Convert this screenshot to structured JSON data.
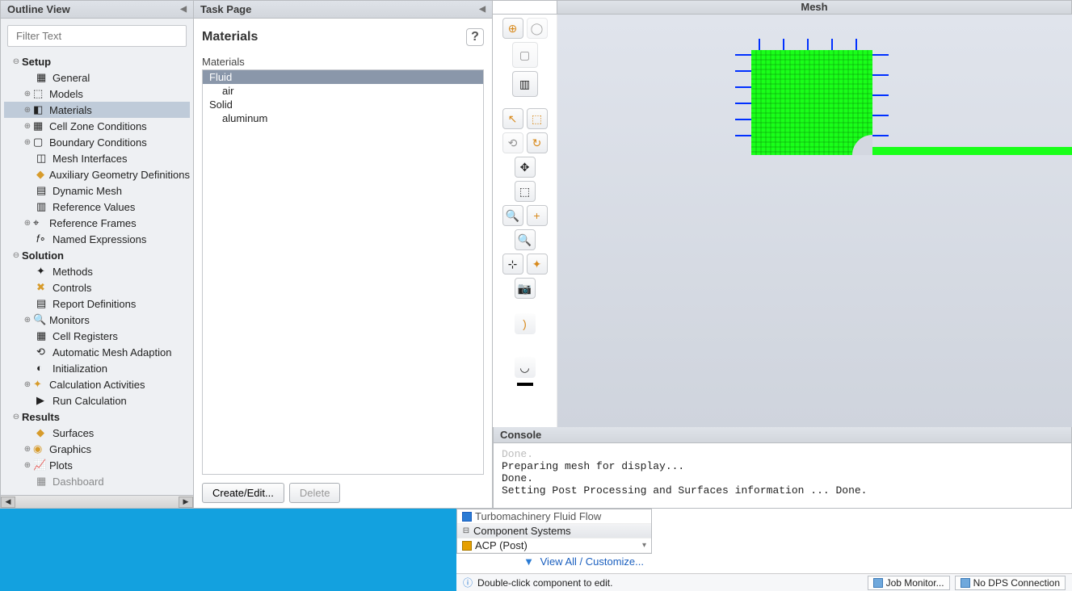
{
  "outline": {
    "title": "Outline View",
    "filter_placeholder": "Filter Text",
    "tree": {
      "setup": "Setup",
      "general": "General",
      "models": "Models",
      "materials": "Materials",
      "cell_zone": "Cell Zone Conditions",
      "boundary": "Boundary Conditions",
      "mesh_if": "Mesh Interfaces",
      "aux_geo": "Auxiliary Geometry Definitions",
      "dyn_mesh": "Dynamic Mesh",
      "ref_vals": "Reference Values",
      "ref_frames": "Reference Frames",
      "named_expr": "Named Expressions",
      "solution": "Solution",
      "methods": "Methods",
      "controls": "Controls",
      "report_def": "Report Definitions",
      "monitors": "Monitors",
      "cell_reg": "Cell Registers",
      "auto_mesh": "Automatic Mesh Adaption",
      "init": "Initialization",
      "calc_act": "Calculation Activities",
      "run_calc": "Run Calculation",
      "results": "Results",
      "surfaces": "Surfaces",
      "graphics": "Graphics",
      "plots": "Plots",
      "dashboard": "Dashboard"
    }
  },
  "task": {
    "title": "Task Page",
    "section": "Materials",
    "list_label": "Materials",
    "items": {
      "fluid": "Fluid",
      "air": "air",
      "solid": "Solid",
      "aluminum": "aluminum"
    },
    "create_edit": "Create/Edit...",
    "delete": "Delete"
  },
  "view": {
    "title": "Mesh"
  },
  "console": {
    "title": "Console",
    "lines": [
      "Done.",
      "",
      "Preparing mesh for display...",
      "Done.",
      "",
      "Setting Post Processing and Surfaces information ...  Done."
    ]
  },
  "workbench": {
    "turbo": "Turbomachinery Fluid Flow",
    "comp_sys": "Component Systems",
    "acp_post": "ACP (Post)",
    "view_all": "View All / Customize...",
    "hint": "Double-click component to edit.",
    "job_monitor": "Job Monitor...",
    "no_dps": "No DPS Connection"
  }
}
